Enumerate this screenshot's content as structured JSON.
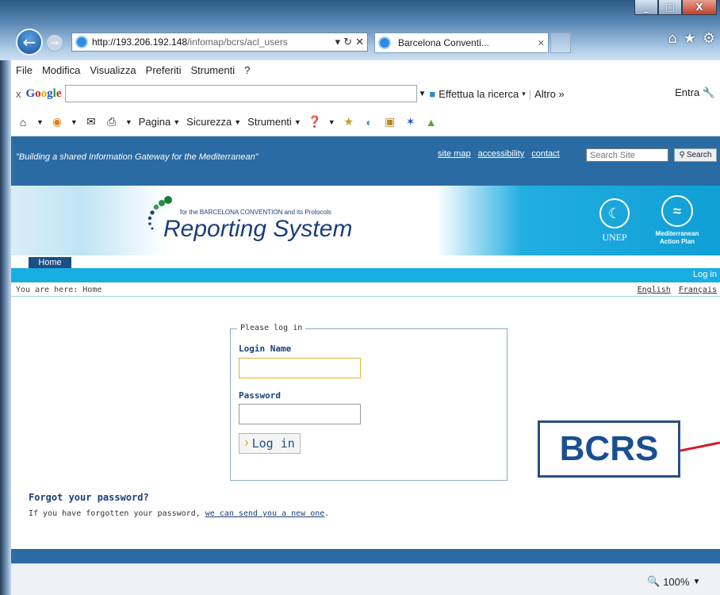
{
  "browser": {
    "url_host": "http://193.206.192.148",
    "url_rest": "/infomap/bcrs/acl_users",
    "tab_label": "Barcelona Conventi...",
    "window_buttons": [
      "_",
      "□",
      "X"
    ],
    "menu": [
      "File",
      "Modifica",
      "Visualizza",
      "Preferiti",
      "Strumenti",
      "?"
    ],
    "google": {
      "close": "x",
      "logo": "Google",
      "search_action": "Effettua la ricerca",
      "more": "Altro »",
      "enter": "Entra"
    },
    "commands": [
      "Pagina",
      "Sicurezza",
      "Strumenti"
    ],
    "zoom": "100%"
  },
  "site": {
    "tagline": "\"Building a shared Information Gateway for the Mediterranean\"",
    "top_links": [
      "site map",
      "accessibility",
      "contact"
    ],
    "search_placeholder": "Search Site",
    "search_button": "Search",
    "banner": {
      "subtitle": "for the BARCELONA CONVENTION and its Protocols",
      "title": "Reporting System",
      "unep": "UNEP",
      "map_label": "Mediterranean Action Plan"
    },
    "nav_home": "Home",
    "login_link": "Log in",
    "breadcrumb": "You are here: Home",
    "languages": [
      "English",
      "Français"
    ]
  },
  "login": {
    "legend": "Please log in",
    "name_label": "Login Name",
    "name_value": "",
    "password_label": "Password",
    "password_value": "",
    "button": "Log in"
  },
  "forgot": {
    "heading": "Forgot your password?",
    "text_before": "If you have forgotten your password,",
    "link": "we can send you a new one",
    "text_after": "."
  },
  "callout": {
    "label": "BCRS",
    "color": "#1a4f8f"
  }
}
